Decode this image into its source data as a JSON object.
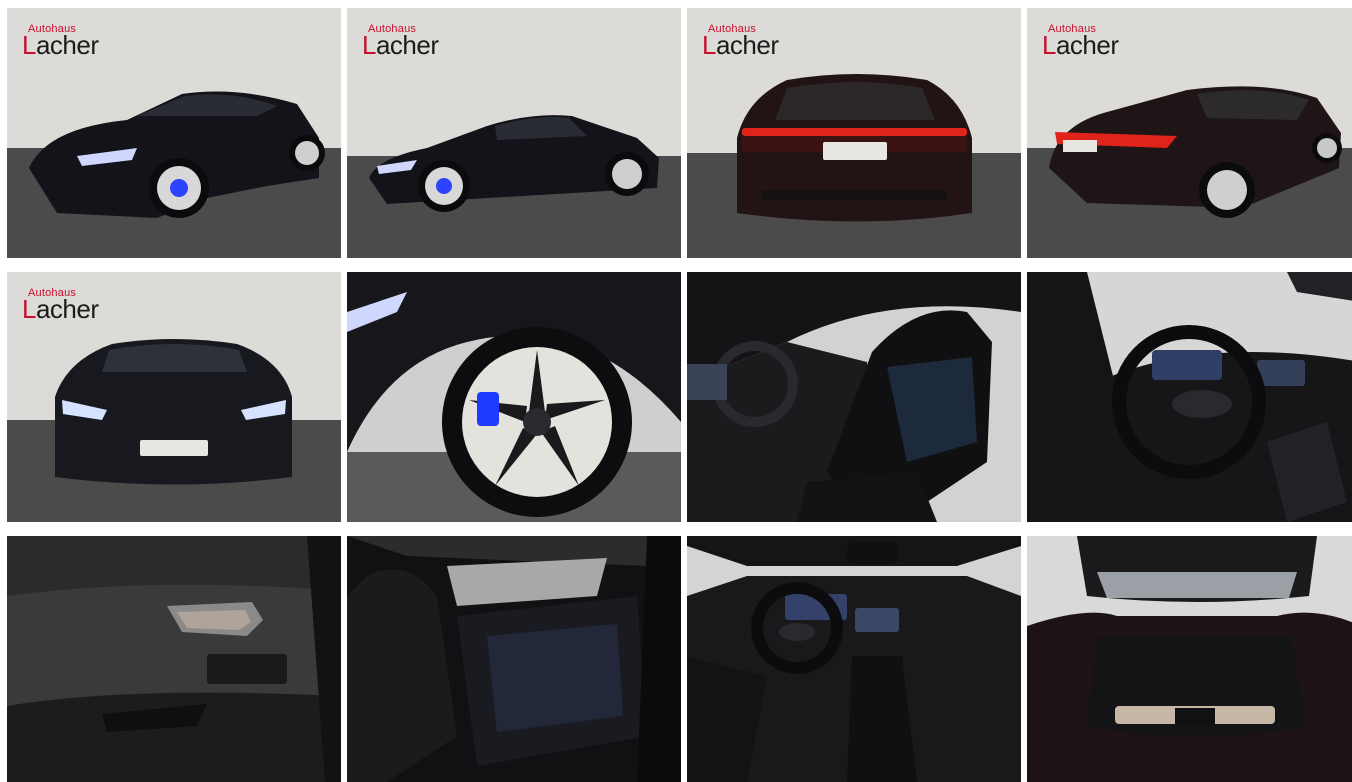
{
  "gallery": {
    "dealer_logo": {
      "small": "Autohaus",
      "big": "Lacher"
    },
    "tiles": [
      {
        "view": "exterior-front-left"
      },
      {
        "view": "exterior-side-left"
      },
      {
        "view": "exterior-rear"
      },
      {
        "view": "exterior-rear-left"
      },
      {
        "view": "exterior-front"
      },
      {
        "view": "wheel-detail"
      },
      {
        "view": "interior-front-seats"
      },
      {
        "view": "interior-steering-wheel"
      },
      {
        "view": "interior-door-panel"
      },
      {
        "view": "interior-rear-seats"
      },
      {
        "view": "interior-dashboard"
      },
      {
        "view": "trunk-open"
      }
    ]
  },
  "colors": {
    "wall": "#dcdbd7",
    "floor": "#4b4b4b",
    "car_body": "#14131a",
    "tail_light": "#e0241b",
    "brake_caliper": "#1e3cff",
    "logo_red": "#c8102e"
  }
}
